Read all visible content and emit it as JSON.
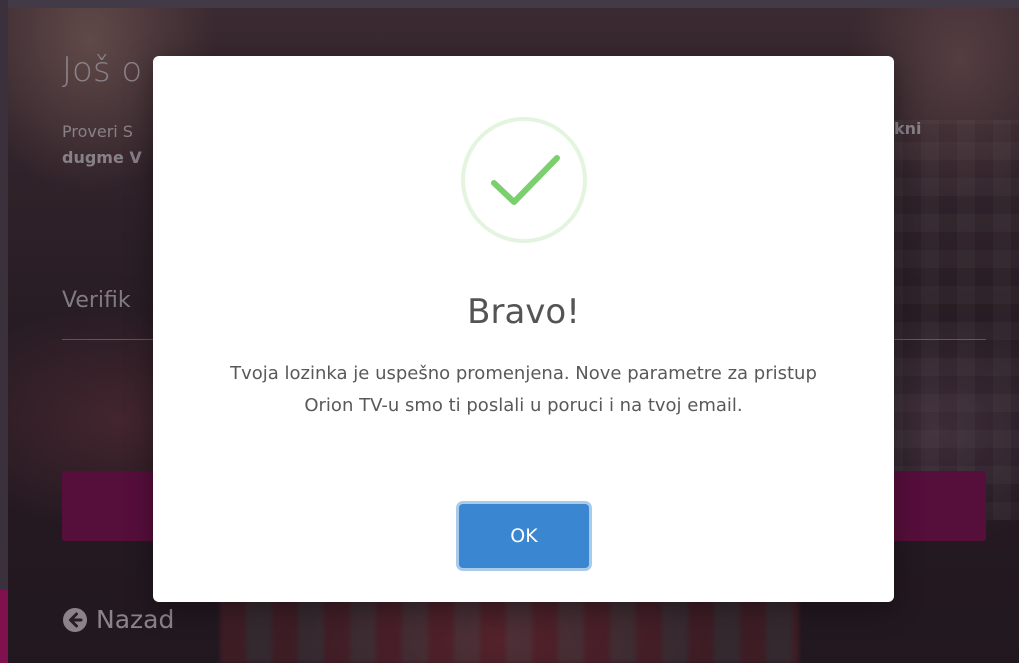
{
  "page": {
    "heading": "Još o",
    "description_line1": "Proveri S",
    "description_line2_bold": "dugme V",
    "description_right_bold": "kni",
    "field_label": "Verifik",
    "back_label": "Nazad"
  },
  "modal": {
    "title": "Bravo!",
    "message": "Tvoja lozinka je uspešno promenjena. Nove parametre za pristup Orion TV-u smo ti poslali u poruci i na tvoj email.",
    "ok_label": "OK",
    "icon": "checkmark-circle-icon"
  },
  "colors": {
    "accent_pink": "#d6157d",
    "submit_button": "#8d0f5a",
    "ok_button": "#3a86d0",
    "success_green": "#7ccf6e"
  }
}
